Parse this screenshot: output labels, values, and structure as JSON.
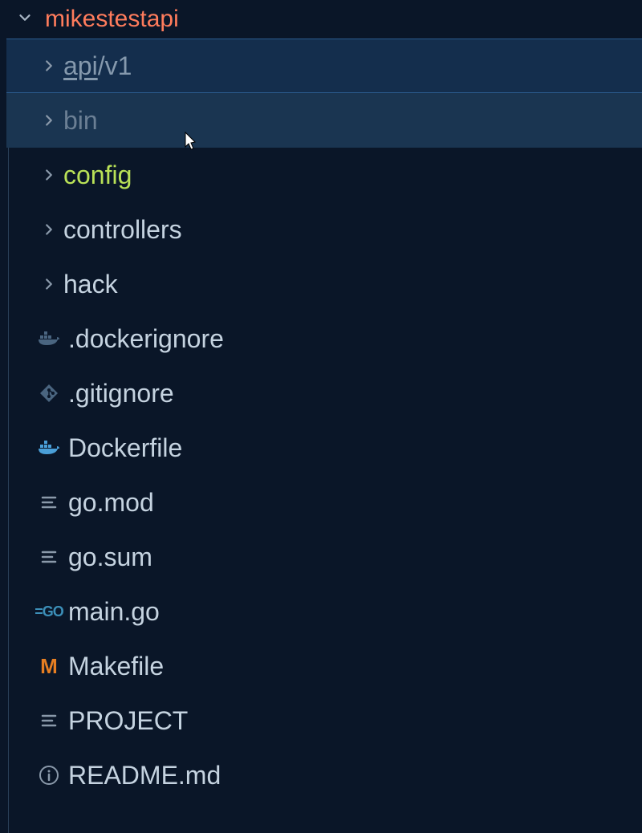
{
  "root": {
    "name": "mikestestapi",
    "expanded": true
  },
  "items": [
    {
      "type": "folder",
      "label": "api",
      "suffix": "/v1",
      "selected": true,
      "icon": "chevron-right"
    },
    {
      "type": "folder",
      "label": "bin",
      "hovered": true,
      "dimmed": true,
      "icon": "chevron-right"
    },
    {
      "type": "folder",
      "label": "config",
      "class": "config",
      "icon": "chevron-right"
    },
    {
      "type": "folder",
      "label": "controllers",
      "icon": "chevron-right"
    },
    {
      "type": "folder",
      "label": "hack",
      "icon": "chevron-right"
    },
    {
      "type": "file",
      "label": ".dockerignore",
      "icon": "docker-dim"
    },
    {
      "type": "file",
      "label": ".gitignore",
      "icon": "git"
    },
    {
      "type": "file",
      "label": "Dockerfile",
      "icon": "docker"
    },
    {
      "type": "file",
      "label": "go.mod",
      "icon": "text"
    },
    {
      "type": "file",
      "label": "go.sum",
      "icon": "text"
    },
    {
      "type": "file",
      "label": "main.go",
      "icon": "go"
    },
    {
      "type": "file",
      "label": "Makefile",
      "icon": "makefile"
    },
    {
      "type": "file",
      "label": "PROJECT",
      "icon": "text"
    },
    {
      "type": "file",
      "label": "README.md",
      "icon": "info"
    }
  ]
}
